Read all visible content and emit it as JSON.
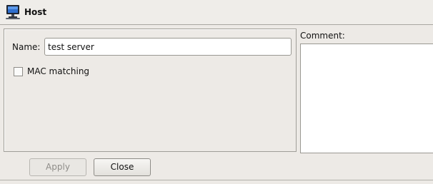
{
  "window": {
    "title": "Host",
    "title_icon": "computer-monitor-icon"
  },
  "form": {
    "name_label": "Name:",
    "name_value": "test server",
    "mac_label": "MAC matching",
    "mac_checked": false
  },
  "comment": {
    "label": "Comment:",
    "value": ""
  },
  "buttons": {
    "apply_label": "Apply",
    "apply_enabled": false,
    "close_label": "Close"
  }
}
